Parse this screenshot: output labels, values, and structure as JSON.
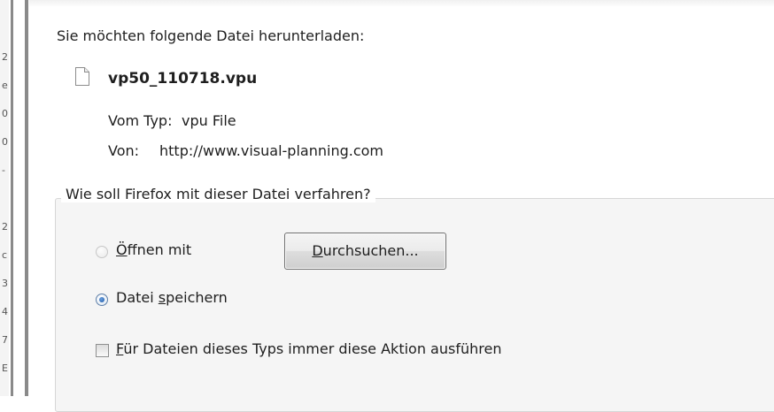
{
  "background_window": {
    "edge_chars": [
      "2",
      "e",
      "0",
      "0",
      "-",
      "2",
      "c",
      "3",
      "4",
      "7",
      "E"
    ]
  },
  "dialog": {
    "intro_text": "Sie möchten folgende Datei herunterladen:",
    "file": {
      "icon": "file-icon",
      "name": "vp50_110718.vpu",
      "type_label": "Vom Typ:",
      "type_value": "vpu File",
      "source_label": "Von:",
      "source_value": "http://www.visual-planning.com"
    },
    "action_group": {
      "legend": "Wie soll Firefox mit dieser Datei verfahren?",
      "open_with": {
        "mnemonic": "Ö",
        "label_rest": "ffnen mit",
        "checked": false,
        "enabled": false
      },
      "browse_button": {
        "mnemonic": "D",
        "label_rest": "urchsuchen..."
      },
      "save_file": {
        "label_before": "Datei ",
        "mnemonic": "s",
        "label_after": "peichern",
        "checked": true
      },
      "always_do": {
        "mnemonic": "F",
        "label_rest": "ür Dateien dieses Typs immer diese Aktion ausführen",
        "checked": false
      }
    }
  },
  "colors": {
    "radio_selected": "#1f58a6",
    "group_background": "#f5f5f5",
    "text": "#1e1e1e"
  }
}
